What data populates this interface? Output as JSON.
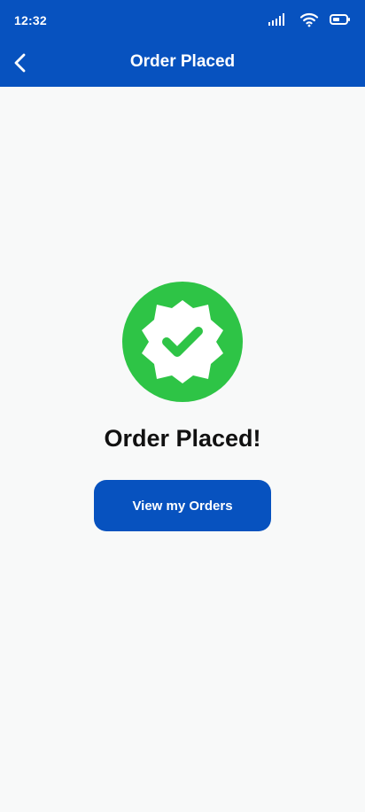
{
  "status_bar": {
    "time": "12:32",
    "icons": [
      "signal-icon",
      "wifi-icon",
      "battery-icon"
    ]
  },
  "app_bar": {
    "title": "Order Placed",
    "back_icon": "chevron-left-icon"
  },
  "success": {
    "icon": "verified-check-badge-icon",
    "title": "Order Placed!",
    "button_label": "View my Orders"
  },
  "colors": {
    "primary": "#0752bf",
    "success": "#2ec446",
    "background": "#f8f9f9",
    "text": "#111111"
  }
}
